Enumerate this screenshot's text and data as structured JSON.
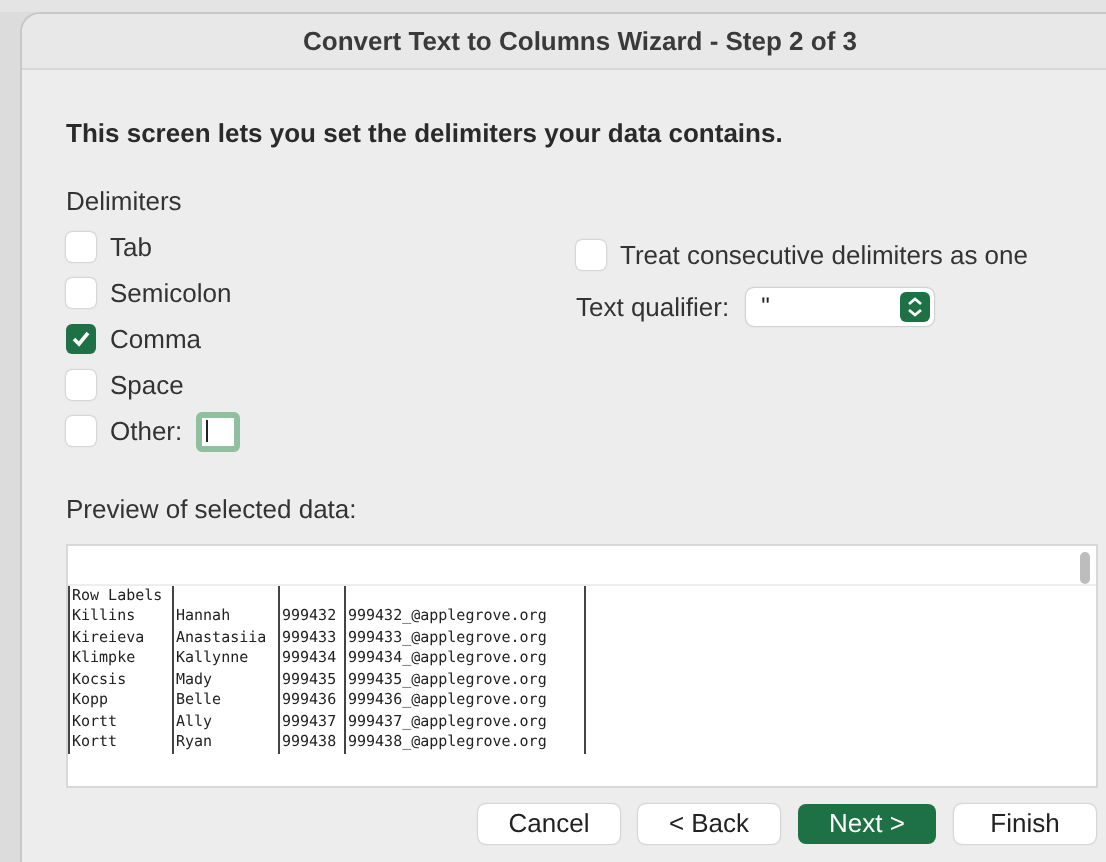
{
  "window": {
    "title": "Convert Text to Columns Wizard - Step 2 of 3"
  },
  "instruction": "This screen lets you set the delimiters your data contains.",
  "delimiters_label": "Delimiters",
  "delimiters": [
    {
      "label": "Tab",
      "checked": false
    },
    {
      "label": "Semicolon",
      "checked": false
    },
    {
      "label": "Comma",
      "checked": true
    },
    {
      "label": "Space",
      "checked": false
    },
    {
      "label": "Other:",
      "checked": false
    }
  ],
  "other_field": {
    "focused": true
  },
  "consecutive": {
    "label": "Treat consecutive delimiters as one",
    "checked": false
  },
  "text_qualifier": {
    "label": "Text qualifier:",
    "value": "\""
  },
  "preview": {
    "label": "Preview of selected data:",
    "rows": [
      [
        "Row Labels"
      ],
      [
        "Killins",
        "Hannah",
        "999432",
        "999432_@applegrove.org"
      ],
      [
        "Kireieva",
        "Anastasiia",
        "999433",
        "999433_@applegrove.org"
      ],
      [
        "Klimpke",
        "Kallynne",
        "999434",
        "999434_@applegrove.org"
      ],
      [
        "Kocsis",
        "Mady",
        "999435",
        "999435_@applegrove.org"
      ],
      [
        "Kopp",
        "Belle",
        "999436",
        "999436_@applegrove.org"
      ],
      [
        "Kortt",
        "Ally",
        "999437",
        "999437_@applegrove.org"
      ],
      [
        "Kortt",
        "Ryan",
        "999438",
        "999438_@applegrove.org"
      ]
    ]
  },
  "buttons": [
    {
      "label": "Cancel",
      "primary": false
    },
    {
      "label": "< Back",
      "primary": false
    },
    {
      "label": "Next >",
      "primary": true
    },
    {
      "label": "Finish",
      "primary": false
    }
  ]
}
